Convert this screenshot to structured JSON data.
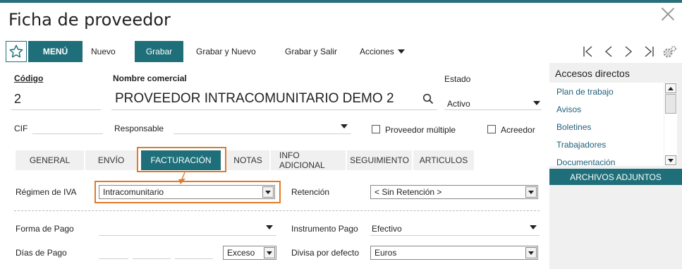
{
  "window": {
    "title": "Ficha de proveedor"
  },
  "toolbar": {
    "menu_label": "MENÚ",
    "nuevo": "Nuevo",
    "grabar": "Grabar",
    "grabar_nuevo": "Grabar y Nuevo",
    "grabar_salir": "Grabar y Salir",
    "acciones": "Acciones"
  },
  "header": {
    "codigo_label": "Código",
    "codigo_value": "2",
    "nombre_label": "Nombre comercial",
    "nombre_value": "PROVEEDOR INTRACOMUNITARIO DEMO 2",
    "estado_label": "Estado",
    "estado_value": "Activo",
    "cif_label": "CIF",
    "cif_value": "",
    "responsable_label": "Responsable",
    "responsable_value": "",
    "proveedor_multiple": "Proveedor múltiple",
    "acreedor": "Acreedor"
  },
  "tabs": [
    {
      "label": "GENERAL",
      "active": false
    },
    {
      "label": "ENVÍO",
      "active": false
    },
    {
      "label": "FACTURACIÓN",
      "active": true
    },
    {
      "label": "NOTAS",
      "active": false
    },
    {
      "label": "INFO ADICIONAL",
      "active": false
    },
    {
      "label": "SEGUIMIENTO",
      "active": false
    },
    {
      "label": "ARTICULOS",
      "active": false
    }
  ],
  "billing": {
    "regimen_label": "Régimen de IVA",
    "regimen_value": "Intracomunitario",
    "retencion_label": "Retención",
    "retencion_value": "< Sin Retención >",
    "forma_pago_label": "Forma de Pago",
    "forma_pago_value": "",
    "instrumento_label": "Instrumento Pago",
    "instrumento_value": "Efectivo",
    "dias_pago_label": "Días de Pago",
    "exceso_value": "Exceso",
    "divisa_label": "Divisa por defecto",
    "divisa_value": "Euros"
  },
  "sidebar": {
    "title": "Accesos directos",
    "items": [
      "Plan de trabajo",
      "Avisos",
      "Boletines",
      "Trabajadores",
      "Documentación"
    ],
    "button": "ARCHIVOS ADJUNTOS"
  },
  "colors": {
    "accent": "#1f6f7a",
    "highlight": "#e07b2a",
    "link": "#1f5f7a"
  }
}
